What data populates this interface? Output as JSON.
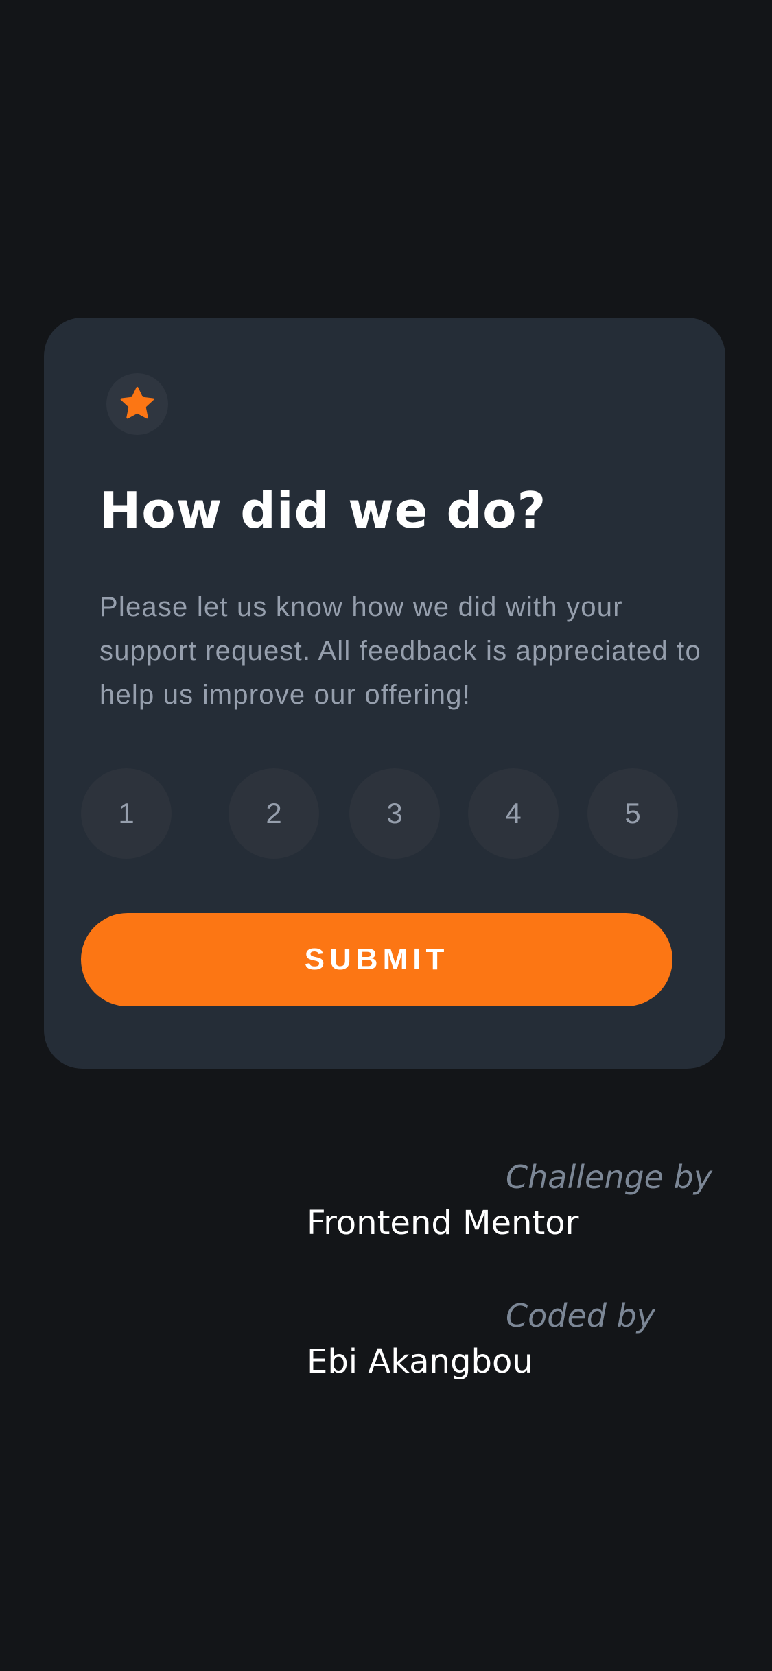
{
  "card": {
    "icon": "star-icon",
    "title": "How did we do?",
    "description": "Please let us know how we did with your support request. All feedback is appreciated to help us improve our offering!",
    "ratings": [
      "1",
      "2",
      "3",
      "4",
      "5"
    ],
    "submit_label": "SUBMIT"
  },
  "attribution": {
    "challenge_label": "Challenge by",
    "challenge_name": "Frontend Mentor",
    "coded_label": "Coded by",
    "coded_name": "Ebi Akangbou"
  },
  "colors": {
    "background": "#131518",
    "card": "#252d37",
    "accent": "#fc7614",
    "muted_text": "#969fad",
    "rating_bg": "#2d333c"
  }
}
